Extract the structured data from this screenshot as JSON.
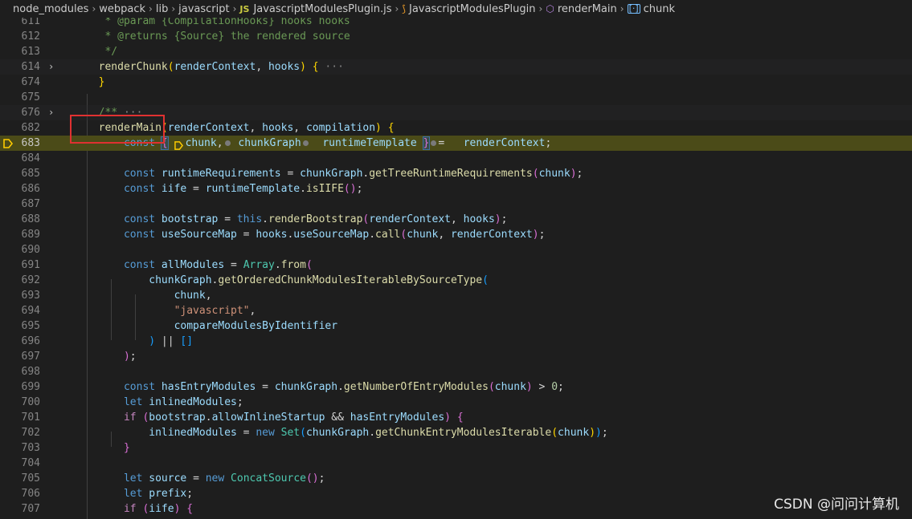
{
  "breadcrumb": {
    "items": [
      "node_modules",
      "webpack",
      "lib",
      "javascript",
      "JavascriptModulesPlugin.js",
      "JavascriptModulesPlugin",
      "renderMain",
      "chunk"
    ],
    "js_badge": "JS"
  },
  "editor": {
    "lines": [
      {
        "n": "611",
        "tokens": [
          [
            "c",
            "   * @param {CompilationHooks} hooks hooks"
          ]
        ]
      },
      {
        "n": "612",
        "tokens": [
          [
            "c",
            "   * @returns {Source} the rendered source"
          ]
        ]
      },
      {
        "n": "613",
        "tokens": [
          [
            "c",
            "   */"
          ]
        ]
      },
      {
        "n": "614",
        "fold": "›",
        "folded": true,
        "tokens": [
          [
            "f",
            "  renderChunk"
          ],
          [
            "p1",
            "("
          ],
          [
            "v",
            "renderContext"
          ],
          [
            "d",
            ", "
          ],
          [
            "v",
            "hooks"
          ],
          [
            "p1",
            ")"
          ],
          [
            "d",
            " "
          ],
          [
            "p1",
            "{"
          ],
          [
            "dim",
            " ···"
          ]
        ]
      },
      {
        "n": "674",
        "tokens": [
          [
            "p1",
            "  }"
          ]
        ]
      },
      {
        "n": "675",
        "tokens": []
      },
      {
        "n": "676",
        "fold": "›",
        "folded": true,
        "tokens": [
          [
            "c",
            "  /**"
          ],
          [
            "dim",
            " ···"
          ]
        ]
      },
      {
        "n": "682",
        "tokens": [
          [
            "f",
            "  renderMain"
          ],
          [
            "p1",
            "("
          ],
          [
            "v",
            "renderContext"
          ],
          [
            "d",
            ", "
          ],
          [
            "v",
            "hooks"
          ],
          [
            "d",
            ", "
          ],
          [
            "v",
            "compilation"
          ],
          [
            "p1",
            ")"
          ],
          [
            "d",
            " "
          ],
          [
            "p1",
            "{"
          ]
        ]
      },
      {
        "n": "683",
        "active": true,
        "tokens": [
          [
            "k",
            "      const"
          ],
          [
            "d",
            " "
          ],
          [
            "p2sel",
            "{"
          ],
          [
            "d",
            " "
          ],
          [
            "bp",
            ""
          ],
          [
            "v",
            "chunk"
          ],
          [
            "d",
            ","
          ],
          [
            "dot",
            ""
          ],
          [
            "d",
            " "
          ],
          [
            "v",
            "chunkGraph"
          ],
          [
            "dot",
            ""
          ],
          [
            "d",
            "  "
          ],
          [
            "v",
            "runtimeTemplate"
          ],
          [
            "d",
            " "
          ],
          [
            "p2sel",
            "}"
          ],
          [
            "dot",
            ""
          ],
          [
            "d",
            "=   "
          ],
          [
            "v",
            "renderContext"
          ],
          [
            "d",
            ";"
          ]
        ]
      },
      {
        "n": "684",
        "tokens": []
      },
      {
        "n": "685",
        "tokens": [
          [
            "k",
            "      const"
          ],
          [
            "d",
            " "
          ],
          [
            "v",
            "runtimeRequirements"
          ],
          [
            "d",
            " = "
          ],
          [
            "v",
            "chunkGraph"
          ],
          [
            "d",
            "."
          ],
          [
            "f",
            "getTreeRuntimeRequirements"
          ],
          [
            "p2",
            "("
          ],
          [
            "v",
            "chunk"
          ],
          [
            "p2",
            ")"
          ],
          [
            "d",
            ";"
          ]
        ]
      },
      {
        "n": "686",
        "tokens": [
          [
            "k",
            "      const"
          ],
          [
            "d",
            " "
          ],
          [
            "v",
            "iife"
          ],
          [
            "d",
            " = "
          ],
          [
            "v",
            "runtimeTemplate"
          ],
          [
            "d",
            "."
          ],
          [
            "f",
            "isIIFE"
          ],
          [
            "p2",
            "()"
          ],
          [
            "d",
            ";"
          ]
        ]
      },
      {
        "n": "687",
        "tokens": []
      },
      {
        "n": "688",
        "tokens": [
          [
            "k",
            "      const"
          ],
          [
            "d",
            " "
          ],
          [
            "v",
            "bootstrap"
          ],
          [
            "d",
            " = "
          ],
          [
            "k",
            "this"
          ],
          [
            "d",
            "."
          ],
          [
            "f",
            "renderBootstrap"
          ],
          [
            "p2",
            "("
          ],
          [
            "v",
            "renderContext"
          ],
          [
            "d",
            ", "
          ],
          [
            "v",
            "hooks"
          ],
          [
            "p2",
            ")"
          ],
          [
            "d",
            ";"
          ]
        ]
      },
      {
        "n": "689",
        "tokens": [
          [
            "k",
            "      const"
          ],
          [
            "d",
            " "
          ],
          [
            "v",
            "useSourceMap"
          ],
          [
            "d",
            " = "
          ],
          [
            "v",
            "hooks"
          ],
          [
            "d",
            "."
          ],
          [
            "v",
            "useSourceMap"
          ],
          [
            "d",
            "."
          ],
          [
            "f",
            "call"
          ],
          [
            "p2",
            "("
          ],
          [
            "v",
            "chunk"
          ],
          [
            "d",
            ", "
          ],
          [
            "v",
            "renderContext"
          ],
          [
            "p2",
            ")"
          ],
          [
            "d",
            ";"
          ]
        ]
      },
      {
        "n": "690",
        "tokens": []
      },
      {
        "n": "691",
        "tokens": [
          [
            "k",
            "      const"
          ],
          [
            "d",
            " "
          ],
          [
            "v",
            "allModules"
          ],
          [
            "d",
            " = "
          ],
          [
            "cl",
            "Array"
          ],
          [
            "d",
            "."
          ],
          [
            "f",
            "from"
          ],
          [
            "p2",
            "("
          ]
        ]
      },
      {
        "n": "692",
        "tokens": [
          [
            "v",
            "          chunkGraph"
          ],
          [
            "d",
            "."
          ],
          [
            "f",
            "getOrderedChunkModulesIterableBySourceType"
          ],
          [
            "p3",
            "("
          ]
        ]
      },
      {
        "n": "693",
        "tokens": [
          [
            "v",
            "              chunk"
          ],
          [
            "d",
            ","
          ]
        ]
      },
      {
        "n": "694",
        "tokens": [
          [
            "s",
            "              \"javascript\""
          ],
          [
            "d",
            ","
          ]
        ]
      },
      {
        "n": "695",
        "tokens": [
          [
            "v",
            "              compareModulesByIdentifier"
          ]
        ]
      },
      {
        "n": "696",
        "tokens": [
          [
            "p3",
            "          )"
          ],
          [
            "d",
            " || "
          ],
          [
            "p3",
            "[]"
          ]
        ]
      },
      {
        "n": "697",
        "tokens": [
          [
            "p2",
            "      )"
          ],
          [
            "d",
            ";"
          ]
        ]
      },
      {
        "n": "698",
        "tokens": []
      },
      {
        "n": "699",
        "tokens": [
          [
            "k",
            "      const"
          ],
          [
            "d",
            " "
          ],
          [
            "v",
            "hasEntryModules"
          ],
          [
            "d",
            " = "
          ],
          [
            "v",
            "chunkGraph"
          ],
          [
            "d",
            "."
          ],
          [
            "f",
            "getNumberOfEntryModules"
          ],
          [
            "p2",
            "("
          ],
          [
            "v",
            "chunk"
          ],
          [
            "p2",
            ")"
          ],
          [
            "d",
            " > "
          ],
          [
            "n",
            "0"
          ],
          [
            "d",
            ";"
          ]
        ]
      },
      {
        "n": "700",
        "tokens": [
          [
            "k",
            "      let"
          ],
          [
            "d",
            " "
          ],
          [
            "v",
            "inlinedModules"
          ],
          [
            "d",
            ";"
          ]
        ]
      },
      {
        "n": "701",
        "tokens": [
          [
            "kc",
            "      if"
          ],
          [
            "d",
            " "
          ],
          [
            "p2",
            "("
          ],
          [
            "v",
            "bootstrap"
          ],
          [
            "d",
            "."
          ],
          [
            "v",
            "allowInlineStartup"
          ],
          [
            "d",
            " && "
          ],
          [
            "v",
            "hasEntryModules"
          ],
          [
            "p2",
            ")"
          ],
          [
            "d",
            " "
          ],
          [
            "p2",
            "{"
          ]
        ]
      },
      {
        "n": "702",
        "tokens": [
          [
            "v",
            "          inlinedModules"
          ],
          [
            "d",
            " = "
          ],
          [
            "k",
            "new"
          ],
          [
            "d",
            " "
          ],
          [
            "cl",
            "Set"
          ],
          [
            "p3",
            "("
          ],
          [
            "v",
            "chunkGraph"
          ],
          [
            "d",
            "."
          ],
          [
            "f",
            "getChunkEntryModulesIterable"
          ],
          [
            "p1",
            "("
          ],
          [
            "v",
            "chunk"
          ],
          [
            "p1",
            ")"
          ],
          [
            "p3",
            ")"
          ],
          [
            "d",
            ";"
          ]
        ]
      },
      {
        "n": "703",
        "tokens": [
          [
            "p2",
            "      }"
          ]
        ]
      },
      {
        "n": "704",
        "tokens": []
      },
      {
        "n": "705",
        "tokens": [
          [
            "k",
            "      let"
          ],
          [
            "d",
            " "
          ],
          [
            "v",
            "source"
          ],
          [
            "d",
            " = "
          ],
          [
            "k",
            "new"
          ],
          [
            "d",
            " "
          ],
          [
            "cl",
            "ConcatSource"
          ],
          [
            "p2",
            "()"
          ],
          [
            "d",
            ";"
          ]
        ]
      },
      {
        "n": "706",
        "tokens": [
          [
            "k",
            "      let"
          ],
          [
            "d",
            " "
          ],
          [
            "v",
            "prefix"
          ],
          [
            "d",
            ";"
          ]
        ]
      },
      {
        "n": "707",
        "tokens": [
          [
            "kc",
            "      if"
          ],
          [
            "d",
            " "
          ],
          [
            "p2",
            "("
          ],
          [
            "v",
            "iife"
          ],
          [
            "p2",
            ")"
          ],
          [
            "d",
            " "
          ],
          [
            "p2",
            "{"
          ]
        ]
      }
    ]
  },
  "watermark": "CSDN @问问计算机",
  "colors": {
    "background": "#1e1e1e",
    "active_line": "#4b4b18",
    "highlight_box": "#e03131",
    "breakpoint": "#ffcc00"
  }
}
